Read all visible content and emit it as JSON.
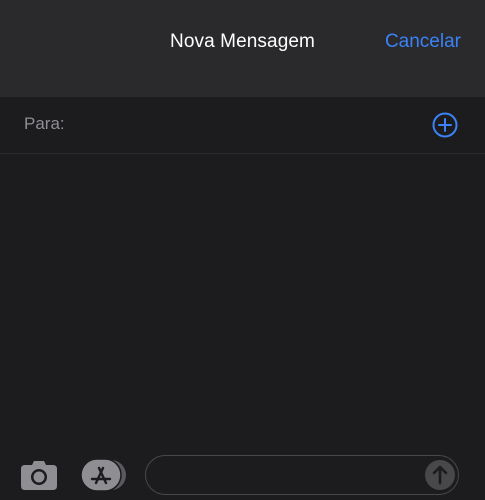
{
  "header": {
    "title": "Nova Mensagem",
    "cancel_label": "Cancelar"
  },
  "recipient": {
    "label": "Para:",
    "add_icon": "plus-circle-icon"
  },
  "composer": {
    "camera_icon": "camera-icon",
    "apps_icon": "app-store-icon",
    "message_value": "",
    "message_placeholder": "",
    "send_icon": "arrow-up-icon"
  },
  "colors": {
    "accent": "#3b82f6",
    "background": "#1c1c1e",
    "header_background": "#2a2a2c",
    "secondary_text": "#8e8e93"
  }
}
